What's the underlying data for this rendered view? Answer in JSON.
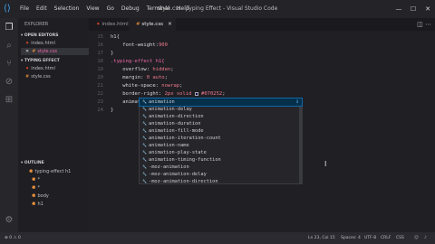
{
  "titlebar": {
    "menu": [
      "File",
      "Edit",
      "Selection",
      "View",
      "Go",
      "Debug",
      "Terminal",
      "Help"
    ],
    "title": "style.css - Typing Effect - Visual Studio Code",
    "minimize": "—",
    "maximize": "☐",
    "close": "✕"
  },
  "sidebar": {
    "title": "EXPLORER",
    "open_editors_label": "OPEN EDITORS",
    "open_editors": [
      "index.html",
      "style.css"
    ],
    "project_label": "TYPING EFFECT",
    "project_files": [
      "index.html",
      "style.css"
    ],
    "outline_label": "OUTLINE",
    "outline_items": [
      "typing-effect h1",
      "*",
      "*",
      "body",
      "h1"
    ]
  },
  "tabs": [
    {
      "label": "index.html",
      "active": false
    },
    {
      "label": "style.css",
      "active": true
    }
  ],
  "code": [
    {
      "ln": "15",
      "parts": [
        [
          "punc",
          "h1{"
        ]
      ]
    },
    {
      "ln": "16",
      "parts": [
        [
          "prop",
          "    font-weight:"
        ],
        [
          "val",
          "900"
        ]
      ]
    },
    {
      "ln": "17",
      "parts": [
        [
          "punc",
          "}"
        ]
      ]
    },
    {
      "ln": "18",
      "parts": [
        [
          "sel",
          ".typing-effect h1{"
        ]
      ]
    },
    {
      "ln": "19",
      "parts": [
        [
          "prop",
          "    overflow: "
        ],
        [
          "val",
          "hidden"
        ],
        [
          "punc",
          ";"
        ]
      ]
    },
    {
      "ln": "20",
      "parts": [
        [
          "prop",
          "    margin: "
        ],
        [
          "val",
          "0 auto"
        ],
        [
          "punc",
          ";"
        ]
      ]
    },
    {
      "ln": "21",
      "parts": [
        [
          "prop",
          "    white-space: "
        ],
        [
          "val",
          "nowrap"
        ],
        [
          "punc",
          ";"
        ]
      ]
    },
    {
      "ln": "22",
      "parts": [
        [
          "prop",
          "    border-right: "
        ],
        [
          "val",
          "2px solid "
        ],
        [
          "swatch",
          ""
        ],
        [
          "val",
          "#070252"
        ],
        [
          "punc",
          ";"
        ]
      ]
    },
    {
      "ln": "23",
      "parts": [
        [
          "prop",
          "    animat"
        ]
      ]
    },
    {
      "ln": "24",
      "parts": [
        [
          "punc",
          "}"
        ]
      ]
    }
  ],
  "suggestions": [
    "animation",
    "animation-delay",
    "animation-direction",
    "animation-duration",
    "animation-fill-mode",
    "animation-iteration-count",
    "animation-name",
    "animation-play-state",
    "animation-timing-function",
    "-moz-animation",
    "-moz-animation-delay",
    "-moz-animation-direction"
  ],
  "suggestion_info": "ℹ",
  "status": {
    "position": "Ln 23, Col 15",
    "spaces": "Spaces: 4",
    "encoding": "UTF-8",
    "eol": "CRLF",
    "language": "CSS"
  }
}
